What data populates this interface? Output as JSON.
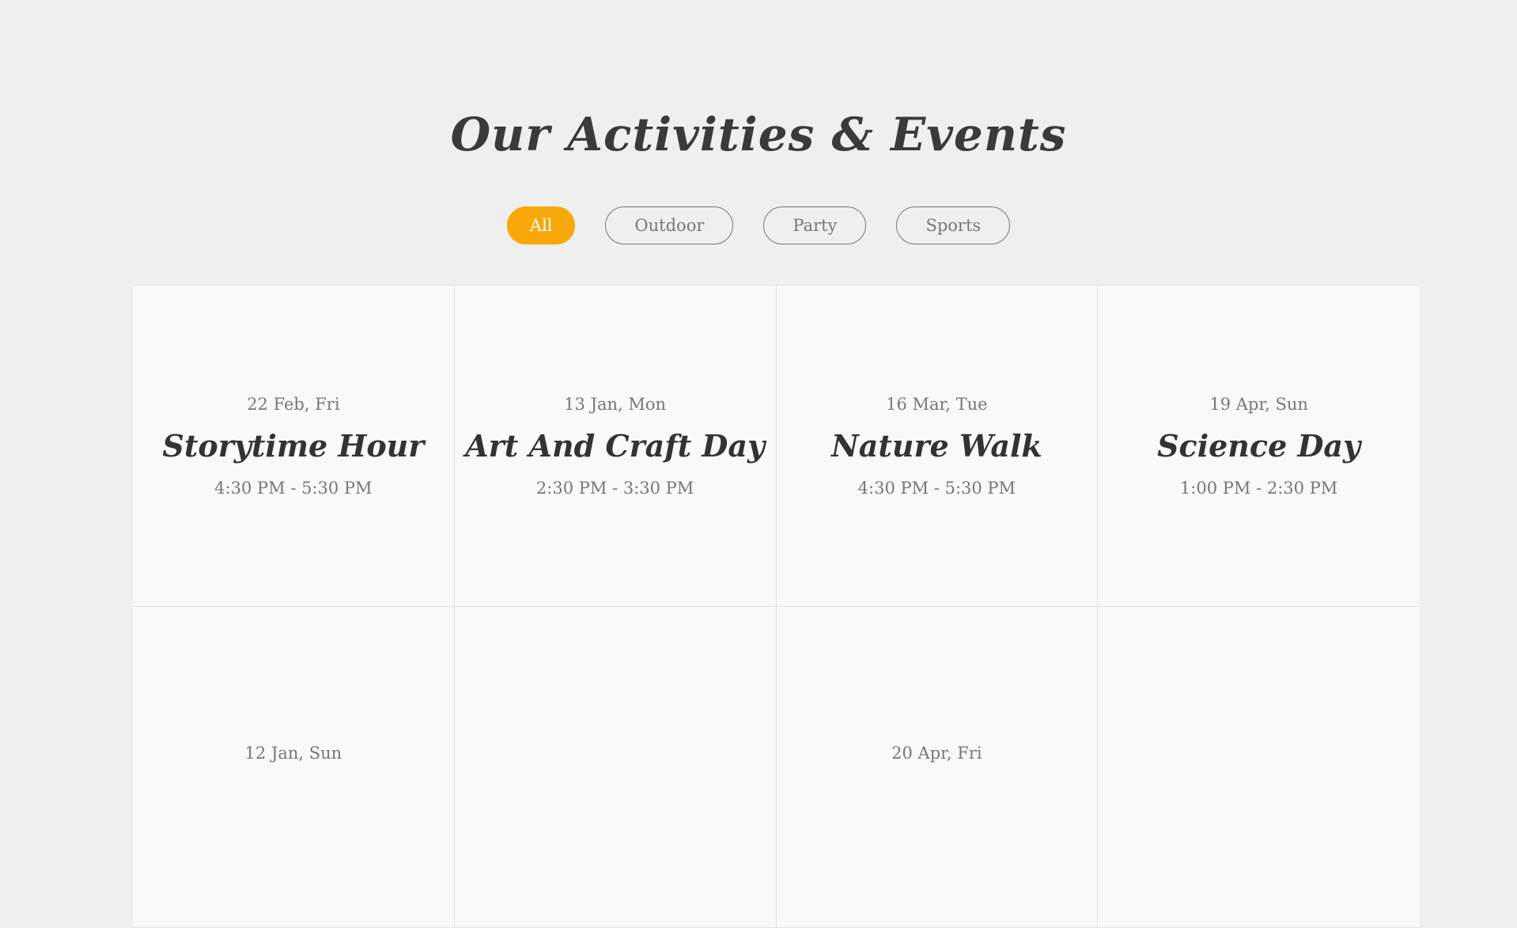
{
  "section": {
    "title": "Our Activities & Events"
  },
  "filters": [
    {
      "label": "All",
      "active": true
    },
    {
      "label": "Outdoor",
      "active": false
    },
    {
      "label": "Party",
      "active": false
    },
    {
      "label": "Sports",
      "active": false
    }
  ],
  "colors": {
    "accent": "#f9a80a",
    "background": "#eeefee",
    "card": "#f9f9f9"
  },
  "events": [
    {
      "date": "22 Feb, Fri",
      "title": "Storytime Hour",
      "time": "4:30 PM - 5:30 PM"
    },
    {
      "date": "13 Jan, Mon",
      "title": "Art And Craft Day",
      "time": "2:30 PM - 3:30 PM"
    },
    {
      "date": "16 Mar, Tue",
      "title": "Nature Walk",
      "time": "4:30 PM - 5:30 PM"
    },
    {
      "date": "19 Apr, Sun",
      "title": "Science Day",
      "time": "1:00 PM - 2:30 PM"
    },
    {
      "date": "12 Jan, Sun",
      "title": "",
      "time": ""
    },
    {
      "date": "",
      "title": "",
      "time": ""
    },
    {
      "date": "20 Apr, Fri",
      "title": "",
      "time": ""
    },
    {
      "date": "",
      "title": "",
      "time": ""
    }
  ]
}
